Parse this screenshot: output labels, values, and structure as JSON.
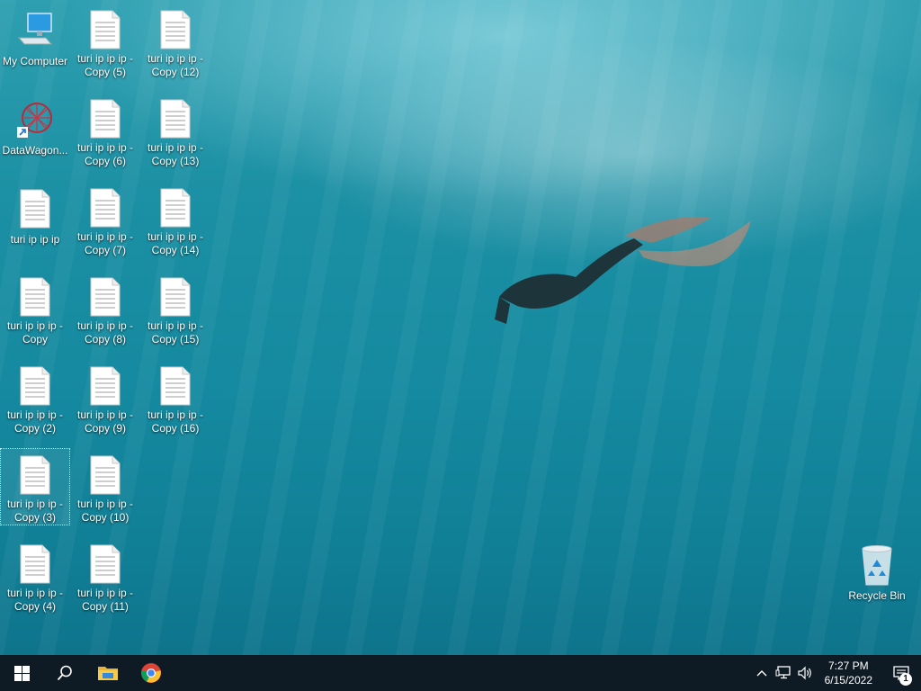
{
  "desktop": {
    "icons": [
      {
        "label": "My Computer",
        "type": "computer"
      },
      {
        "label": "DataWagon...",
        "type": "shortcut"
      },
      {
        "label": "turi ip ip ip",
        "type": "file"
      },
      {
        "label": "turi ip ip ip -\nCopy",
        "type": "file"
      },
      {
        "label": "turi ip ip ip -\nCopy (2)",
        "type": "file"
      },
      {
        "label": "turi ip ip ip -\nCopy (3)",
        "type": "file"
      },
      {
        "label": "turi ip ip ip -\nCopy (4)",
        "type": "file"
      },
      {
        "label": "turi ip ip ip -\nCopy (5)",
        "type": "file"
      },
      {
        "label": "turi ip ip ip -\nCopy (6)",
        "type": "file"
      },
      {
        "label": "turi ip ip ip -\nCopy (7)",
        "type": "file"
      },
      {
        "label": "turi ip ip ip -\nCopy (8)",
        "type": "file"
      },
      {
        "label": "turi ip ip ip -\nCopy (9)",
        "type": "file"
      },
      {
        "label": "turi ip ip ip -\nCopy (10)",
        "type": "file"
      },
      {
        "label": "turi ip ip ip -\nCopy (11)",
        "type": "file"
      },
      {
        "label": "turi ip ip ip -\nCopy (12)",
        "type": "file"
      },
      {
        "label": "turi ip ip ip -\nCopy (13)",
        "type": "file"
      },
      {
        "label": "turi ip ip ip -\nCopy (14)",
        "type": "file"
      },
      {
        "label": "turi ip ip ip -\nCopy (15)",
        "type": "file"
      },
      {
        "label": "turi ip ip ip -\nCopy (16)",
        "type": "file"
      },
      {
        "label": "Recycle Bin",
        "type": "recycle-bin"
      }
    ]
  },
  "taskbar": {
    "buttons": [
      "start-icon",
      "search-icon",
      "file-explorer-icon",
      "chrome-icon"
    ],
    "tray": {
      "icons": [
        "chevron-up-icon",
        "network-icon",
        "volume-icon"
      ],
      "time": "7:27 PM",
      "date": "6/15/2022",
      "notification_count": "1"
    }
  },
  "colors": {
    "taskbar": "#0e1b24",
    "water": "#158aa0"
  }
}
